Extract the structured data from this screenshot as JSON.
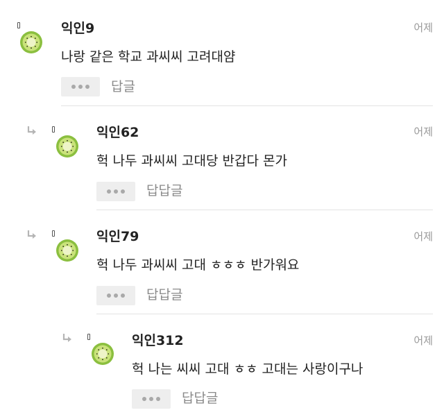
{
  "comments": [
    {
      "author": "익인9",
      "time": "어제",
      "text": "나랑 같은 학교 과씨씨 고려대얌",
      "reply_label": "답글"
    },
    {
      "author": "익인62",
      "time": "어제",
      "text": "헉 나두 과씨씨 고대당 반갑다 몬가",
      "reply_label": "답답글"
    },
    {
      "author": "익인79",
      "time": "어제",
      "text": "헉 나두 과씨씨 고대 ㅎㅎㅎ 반가워요",
      "reply_label": "답답글"
    },
    {
      "author": "익인312",
      "time": "어제",
      "text": "헉 나는 씨씨 고대 ㅎㅎ 고대는 사랑이구나",
      "reply_label": "답답글"
    }
  ],
  "icons": {
    "avatar": "kiwi-avatar-icon",
    "reply_indicator": "reply-arrow-icon",
    "options": "more-dots-icon"
  },
  "colors": {
    "avatar_outer": "#8bbf3f",
    "avatar_inner": "#c9e27a",
    "text": "#222222",
    "muted": "#9a9a9a",
    "button_bg": "#eeeeee"
  }
}
